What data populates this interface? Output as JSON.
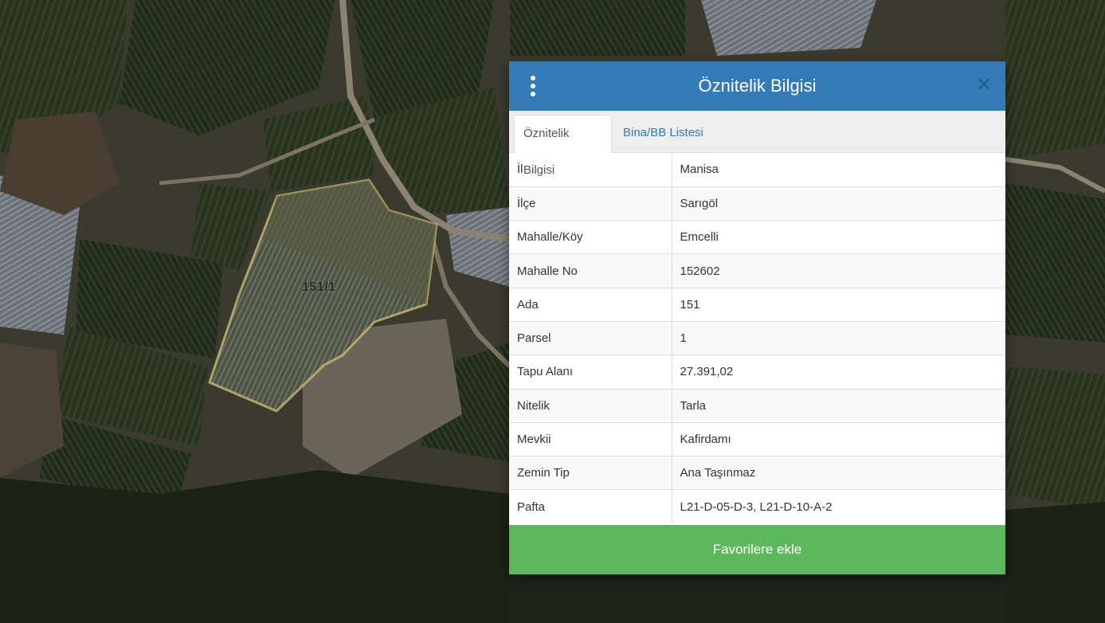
{
  "map": {
    "parcel_label": "151/1",
    "colors": {
      "parcel_outline": "#c8b878",
      "background": "#2b2d22"
    }
  },
  "panel": {
    "title": "Öznitelik Bilgisi",
    "menu_icon": "vertical-ellipsis-icon",
    "close_icon": "close-icon",
    "tabs": [
      {
        "label": "Öznitelik Bilgisi",
        "active": true
      },
      {
        "label": "Bina/BB Listesi",
        "active": false
      }
    ],
    "rows": [
      {
        "key": "İl",
        "value": "Manisa"
      },
      {
        "key": "İlçe",
        "value": "Sarıgöl"
      },
      {
        "key": "Mahalle/Köy",
        "value": "Emcelli"
      },
      {
        "key": "Mahalle No",
        "value": "152602"
      },
      {
        "key": "Ada",
        "value": "151"
      },
      {
        "key": "Parsel",
        "value": "1"
      },
      {
        "key": "Tapu Alanı",
        "value": "27.391,02"
      },
      {
        "key": "Nitelik",
        "value": "Tarla"
      },
      {
        "key": "Mevkii",
        "value": "Kafirdamı"
      },
      {
        "key": "Zemin Tip",
        "value": "Ana Taşınmaz"
      },
      {
        "key": "Pafta",
        "value": "L21-D-05-D-3, L21-D-10-A-2"
      }
    ],
    "favorite_button": "Favorilere ekle",
    "colors": {
      "header": "#337ab7",
      "button": "#5cb85c",
      "tab_link": "#337ab7"
    }
  }
}
